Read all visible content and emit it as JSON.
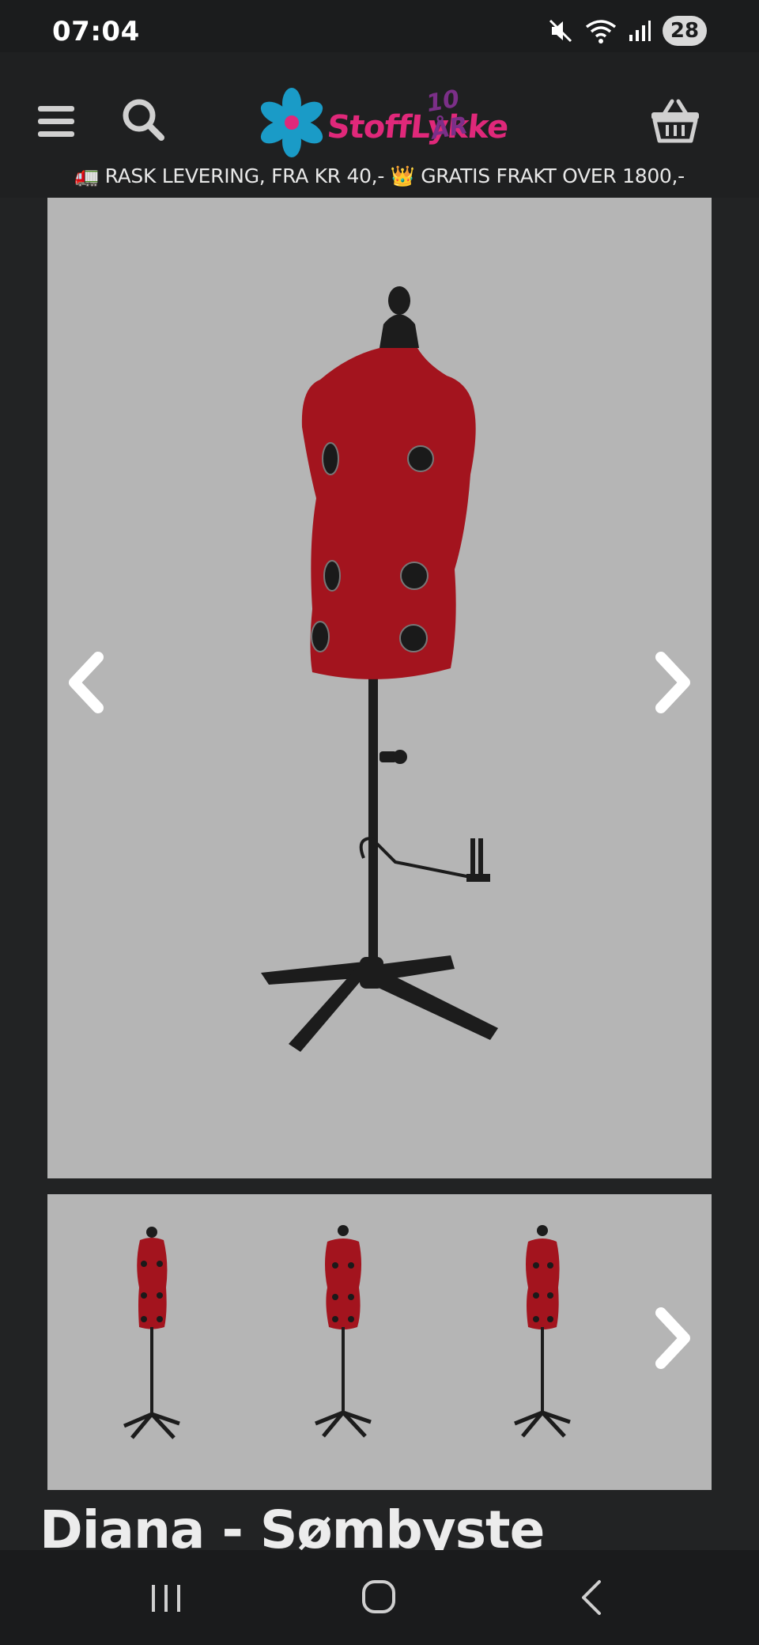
{
  "status_bar": {
    "time": "07:04",
    "battery": "28",
    "icons": [
      "mute-icon",
      "wifi-icon",
      "signal-icon"
    ]
  },
  "header": {
    "logo_text": "StoffLykke",
    "logo_badge": "10 ÅR",
    "menu_icon": "hamburger-menu-icon",
    "search_icon": "search-icon",
    "cart_icon": "basket-icon",
    "promo_part1": "RASK LEVERING, FRA KR 40,-",
    "promo_part2": "GRATIS FRAKT OVER 1800,-",
    "promo_icon1": "🚛",
    "promo_icon2": "👑"
  },
  "gallery": {
    "prev_icon": "chevron-left-icon",
    "next_icon": "chevron-right-icon",
    "thumbnail_count_visible": 3
  },
  "product": {
    "title": "Diana - Sømbyste"
  },
  "nav_bar": {
    "recents_icon": "recent-apps-icon",
    "home_icon": "home-icon",
    "back_icon": "back-icon"
  },
  "colors": {
    "background": "#222324",
    "header": "#1f2021",
    "logo_pink": "#e0287a",
    "logo_purple": "#7b2f88",
    "mannequin_red": "#a3141e",
    "image_bg": "#b5b5b5"
  }
}
